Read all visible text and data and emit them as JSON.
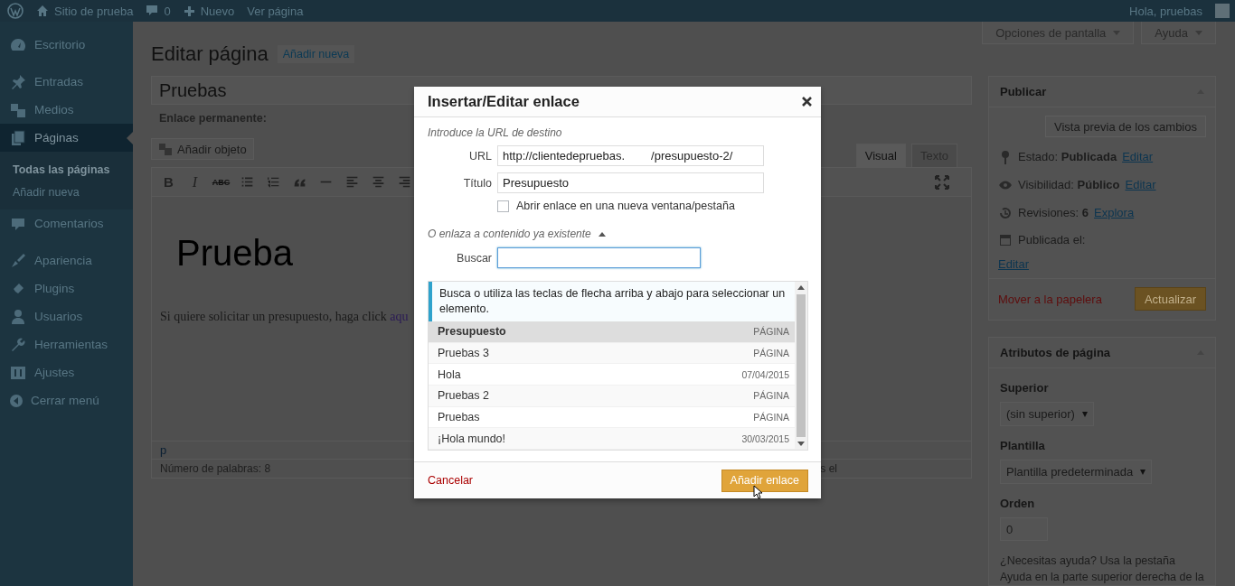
{
  "admin_bar": {
    "site": "Sitio de prueba",
    "comments": "0",
    "new": "Nuevo",
    "view": "Ver página",
    "greeting": "Hola, pruebas"
  },
  "sidebar": {
    "items": [
      {
        "label": "Escritorio",
        "selected": false
      },
      {
        "label": "Entradas",
        "selected": false
      },
      {
        "label": "Medios",
        "selected": false
      },
      {
        "label": "Páginas",
        "selected": true,
        "children": [
          {
            "label": "Todas las páginas",
            "selected": true
          },
          {
            "label": "Añadir nueva",
            "selected": false
          }
        ]
      },
      {
        "label": "Comentarios",
        "selected": false
      },
      {
        "label": "Apariencia",
        "selected": false
      },
      {
        "label": "Plugins",
        "selected": false
      },
      {
        "label": "Usuarios",
        "selected": false
      },
      {
        "label": "Herramientas",
        "selected": false
      },
      {
        "label": "Ajustes",
        "selected": false
      }
    ],
    "collapse": "Cerrar menú"
  },
  "screen_tabs": [
    {
      "label": "Opciones de pantalla"
    },
    {
      "label": "Ayuda"
    }
  ],
  "page": {
    "heading": "Editar página",
    "add_new": "Añadir nueva",
    "title_value": "Pruebas",
    "permalink_label": "Enlace permanente:",
    "add_media": "Añadir objeto",
    "editor_tabs": [
      {
        "label": "Visual",
        "selected": true
      },
      {
        "label": "Texto",
        "selected": false
      }
    ],
    "toolbar_glyphs": [
      "B",
      "I",
      "ABC"
    ],
    "content_heading": "Prueba",
    "content_paragraph": "Si quiere solicitar un presupuesto, haga click",
    "content_link": "aqu",
    "status_path": "p",
    "word_count": "Número de palabras: 8",
    "status_right": "s el"
  },
  "publish": {
    "title": "Publicar",
    "preview": "Vista previa de los cambios",
    "rows": [
      {
        "label": "Estado:",
        "value": "Publicada",
        "link": "Editar"
      },
      {
        "label": "Visibilidad:",
        "value": "Público",
        "link": "Editar"
      },
      {
        "label": "Revisiones:",
        "value": "6",
        "link": "Explora"
      },
      {
        "label": "Publicada el:",
        "link": "Editar"
      }
    ],
    "trash": "Mover a la papelera",
    "update": "Actualizar"
  },
  "attributes": {
    "title": "Atributos de página",
    "parent_label": "Superior",
    "parent_value": "(sin superior)",
    "template_label": "Plantilla",
    "template_value": "Plantilla predeterminada",
    "order_label": "Orden",
    "order_value": "0",
    "help": "¿Necesitas ayuda? Usa la pestaña Ayuda en la parte superior derecha de la"
  },
  "dialog": {
    "title": "Insertar/Editar enlace",
    "intro": "Introduce la URL de destino",
    "url_label": "URL",
    "url_value": "http://clientedepruebas.        /presupuesto-2/",
    "title_label": "Título",
    "title_value": "Presupuesto",
    "new_tab": {
      "label": "Abrir enlace en una nueva ventana/pestaña",
      "checked": false
    },
    "existing": {
      "label": "O enlaza a contenido ya existente",
      "expanded": true
    },
    "search_label": "Buscar",
    "hint": "Busca o utiliza las teclas de flecha arriba y abajo para seleccionar un elemento.",
    "results": [
      {
        "title": "Presupuesto",
        "info": "PÁGINA",
        "selected": true
      },
      {
        "title": "Pruebas 3",
        "info": "PÁGINA",
        "selected": false
      },
      {
        "title": "Hola",
        "info": "07/04/2015",
        "selected": false
      },
      {
        "title": "Pruebas 2",
        "info": "PÁGINA",
        "selected": false
      },
      {
        "title": "Pruebas",
        "info": "PÁGINA",
        "selected": false
      },
      {
        "title": "¡Hola mundo!",
        "info": "30/03/2015",
        "selected": false
      }
    ],
    "cancel": "Cancelar",
    "submit": "Añadir enlace"
  }
}
